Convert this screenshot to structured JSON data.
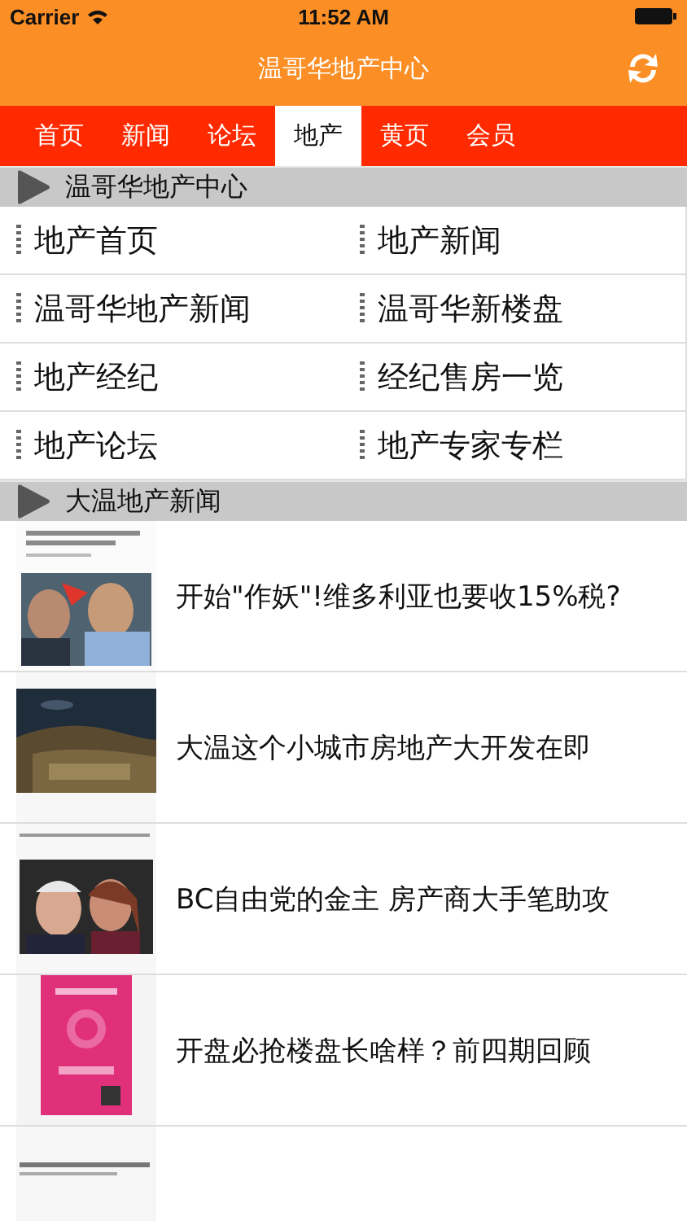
{
  "status_bar": {
    "carrier": "Carrier",
    "time": "11:52 AM"
  },
  "nav_bar": {
    "title": "温哥华地产中心"
  },
  "tabs": [
    {
      "label": "首页",
      "selected": false
    },
    {
      "label": "新闻",
      "selected": false
    },
    {
      "label": "论坛",
      "selected": false
    },
    {
      "label": "地产",
      "selected": true
    },
    {
      "label": "黄页",
      "selected": false
    },
    {
      "label": "会员",
      "selected": false
    }
  ],
  "sections": [
    {
      "title": "温哥华地产中心",
      "kind": "grid",
      "items": [
        "地产首页",
        "地产新闻",
        "温哥华地产新闻",
        "温哥华新楼盘",
        "地产经纪",
        "经纪售房一览",
        "地产论坛",
        "地产专家专栏"
      ]
    },
    {
      "title": "大温地产新闻",
      "kind": "news",
      "items": [
        {
          "title": "开始\"作妖\"!维多利亚也要收15%税?",
          "image": {
            "kind": "picture"
          }
        },
        {
          "title": "大温这个小城市房地产大开发在即",
          "image": {
            "kind": "picture"
          }
        },
        {
          "title": "BC自由党的金主 房产商大手笔助攻",
          "image": {
            "kind": "picture"
          }
        },
        {
          "title": "开盘必抢楼盘长啥样？前四期回顾",
          "image": {
            "kind": "picture"
          }
        },
        {
          "image": {
            "kind": "picture"
          }
        }
      ]
    }
  ]
}
